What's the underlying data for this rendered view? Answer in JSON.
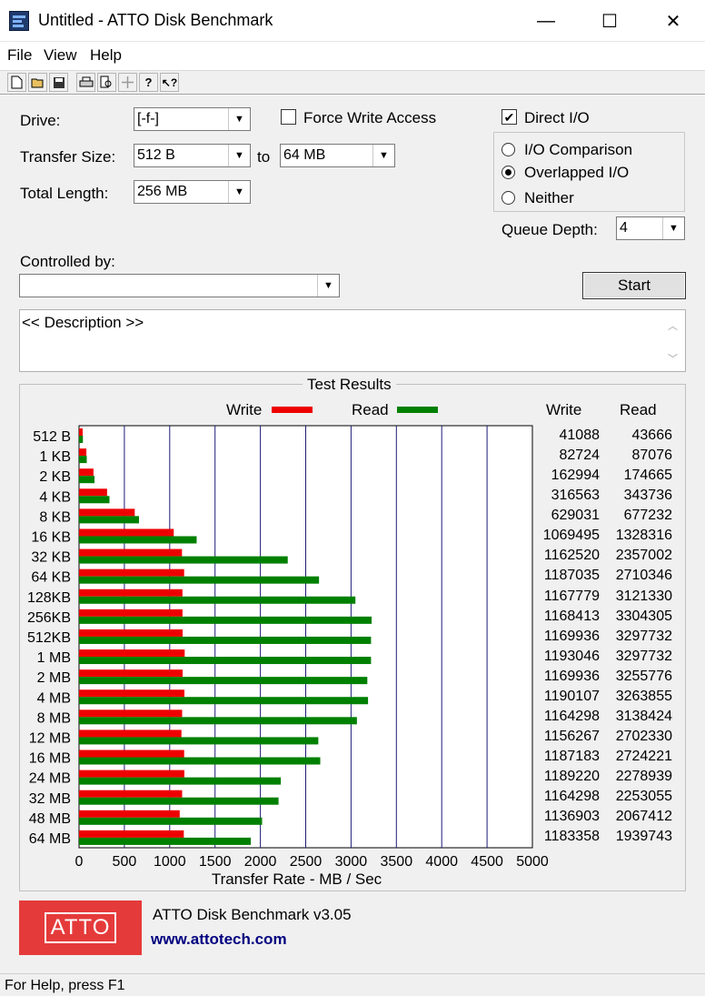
{
  "window": {
    "title": "Untitled - ATTO Disk Benchmark",
    "minimize": "—",
    "maximize": "☐",
    "close": "✕"
  },
  "menu": [
    "File",
    "View",
    "Help"
  ],
  "toolbar": {
    "icons": [
      "new-icon",
      "open-icon",
      "save-icon",
      "print-icon",
      "print-preview-icon",
      "move-icon",
      "help-icon",
      "context-help-icon"
    ]
  },
  "settings": {
    "drive_label": "Drive:",
    "drive_value": "[-f-]",
    "force_write_label": "Force Write Access",
    "force_write_checked": false,
    "direct_io_label": "Direct I/O",
    "direct_io_checked": true,
    "transfer_size_label": "Transfer Size:",
    "transfer_from": "512 B",
    "to_label": "to",
    "transfer_to": "64 MB",
    "total_length_label": "Total Length:",
    "total_length_value": "256 MB",
    "io_options": [
      {
        "label": "I/O Comparison",
        "selected": false
      },
      {
        "label": "Overlapped I/O",
        "selected": true
      },
      {
        "label": "Neither",
        "selected": false
      }
    ],
    "queue_depth_label": "Queue Depth:",
    "queue_depth_value": "4",
    "controlled_by_label": "Controlled by:",
    "controlled_by_value": "",
    "start_button": "Start",
    "description": "<< Description >>"
  },
  "results": {
    "title": "Test Results",
    "legend_write": "Write",
    "legend_read": "Read",
    "col_write": "Write",
    "col_read": "Read",
    "write_color": "#ee0000",
    "read_color": "#008000"
  },
  "chart_data": {
    "type": "bar",
    "orientation": "horizontal",
    "title": "Test Results",
    "xlabel": "Transfer Rate - MB / Sec",
    "ylabel": "",
    "xlim": [
      0,
      5000
    ],
    "xticks": [
      0,
      500,
      1000,
      1500,
      2000,
      2500,
      3000,
      3500,
      4000,
      4500,
      5000
    ],
    "categories": [
      "512 B",
      "1 KB",
      "2 KB",
      "4 KB",
      "8 KB",
      "16 KB",
      "32 KB",
      "64 KB",
      "128KB",
      "256KB",
      "512KB",
      "1 MB",
      "2 MB",
      "4 MB",
      "8 MB",
      "12 MB",
      "16 MB",
      "24 MB",
      "32 MB",
      "48 MB",
      "64 MB"
    ],
    "series": [
      {
        "name": "Write",
        "color": "#ee0000",
        "values": [
          41088,
          82724,
          162994,
          316563,
          629031,
          1069495,
          1162520,
          1187035,
          1167779,
          1168413,
          1169936,
          1193046,
          1169936,
          1190107,
          1164298,
          1156267,
          1187183,
          1189220,
          1164298,
          1136903,
          1183358
        ]
      },
      {
        "name": "Read",
        "color": "#008000",
        "values": [
          43666,
          87076,
          174665,
          343736,
          677232,
          1328316,
          2357002,
          2710346,
          3121330,
          3304305,
          3297732,
          3297732,
          3255776,
          3263855,
          3138424,
          2702330,
          2724221,
          2278939,
          2253055,
          2067412,
          1939743
        ]
      }
    ],
    "values_unit": "KB/s",
    "grid": true,
    "legend": "top"
  },
  "footer": {
    "logo_text": "ATTO",
    "product": "ATTO Disk Benchmark v3.05",
    "url": "www.attotech.com"
  },
  "status": "For Help, press F1"
}
